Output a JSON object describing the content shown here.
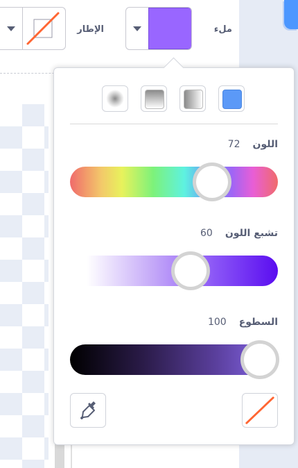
{
  "toolbar": {
    "fill_label": "ملء",
    "outline_label": "الإطار",
    "fill_color": "#9966ff",
    "outline_color": "#ff6633"
  },
  "popover": {
    "gradient_modes": [
      "radial-gradient-icon",
      "vertical-gradient-icon",
      "horizontal-gradient-icon",
      "solid-fill-icon"
    ],
    "selected_mode": "solid",
    "sliders": {
      "color": {
        "label": "اللون",
        "value": "72"
      },
      "saturation": {
        "label": "تشبع اللون",
        "value": "60"
      },
      "brightness": {
        "label": "السطوع",
        "value": "100"
      }
    },
    "tools": [
      "eyedropper-icon",
      "no-color-icon"
    ]
  },
  "colors": {
    "accent": "#4c97ff",
    "selected_fill": "#9966ff",
    "saturation_end": "#5a0df0"
  }
}
